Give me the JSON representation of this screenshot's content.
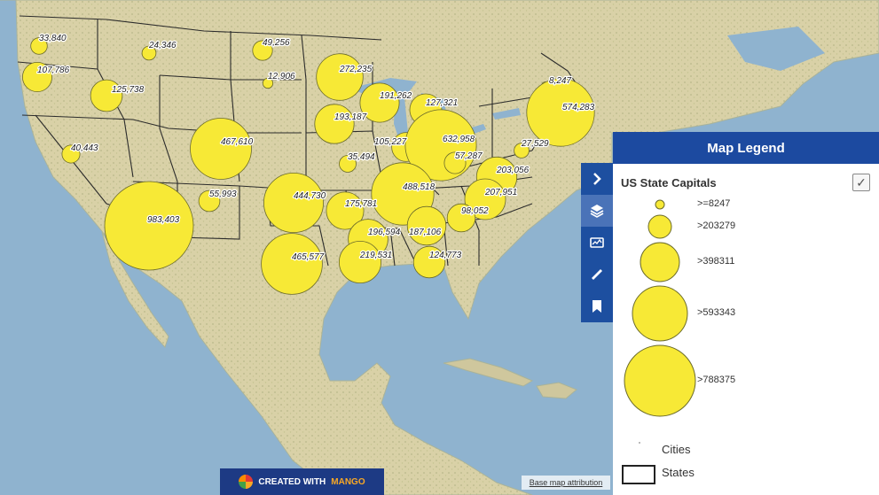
{
  "legend": {
    "title": "Map Legend",
    "layer_title": "US State Capitals",
    "checkbox": "✓",
    "size_classes": [
      ">=8247",
      ">203279",
      ">398311",
      ">593343",
      ">788375"
    ],
    "cities_label": "Cities",
    "states_label": "States"
  },
  "toolbar": {
    "icons": [
      "chevron-right-icon",
      "layers-icon",
      "map-card-icon",
      "ruler-icon",
      "bookmark-icon"
    ]
  },
  "footer": {
    "brand_prefix": "CREATED WITH",
    "brand_accent": "MANGO",
    "attribution": "Base map attribution"
  },
  "colors": {
    "bubble_fill": "#f7e936",
    "bubble_stroke": "#6b6b2a",
    "legend_header": "#1c4aa0",
    "toolbar": "#1d4fa0",
    "ocean": "#8fb3cf",
    "land": "#d8d0a6"
  },
  "capitals": [
    {
      "value": 33840,
      "label": "33,840"
    },
    {
      "value": 24346,
      "label": "24,346"
    },
    {
      "value": 49256,
      "label": "49,256"
    },
    {
      "value": 107786,
      "label": "107,786"
    },
    {
      "value": 125738,
      "label": "125,738"
    },
    {
      "value": 12906,
      "label": "12,906"
    },
    {
      "value": 272235,
      "label": "272,235"
    },
    {
      "value": 8247,
      "label": "8,247"
    },
    {
      "value": 191262,
      "label": "191,262"
    },
    {
      "value": 127321,
      "label": "127,321"
    },
    {
      "value": 574283,
      "label": "574,283"
    },
    {
      "value": 193187,
      "label": "193,187"
    },
    {
      "value": 467610,
      "label": "467,610"
    },
    {
      "value": 40443,
      "label": "40,443"
    },
    {
      "value": 105227,
      "label": "105,227"
    },
    {
      "value": 632958,
      "label": "632,958"
    },
    {
      "value": 27529,
      "label": "27,529"
    },
    {
      "value": 35494,
      "label": "35,494"
    },
    {
      "value": 57287,
      "label": "57,287"
    },
    {
      "value": 203056,
      "label": "203,056"
    },
    {
      "value": 488518,
      "label": "488,518"
    },
    {
      "value": 207951,
      "label": "207,951"
    },
    {
      "value": 55993,
      "label": "55,993"
    },
    {
      "value": 444730,
      "label": "444,730"
    },
    {
      "value": 983403,
      "label": "983,403"
    },
    {
      "value": 175781,
      "label": "175,781"
    },
    {
      "value": 98052,
      "label": "98,052"
    },
    {
      "value": 196594,
      "label": "196,594"
    },
    {
      "value": 187106,
      "label": "187,106"
    },
    {
      "value": 465577,
      "label": "465,577"
    },
    {
      "value": 219531,
      "label": "219,531"
    },
    {
      "value": 124773,
      "label": "124,773"
    }
  ]
}
